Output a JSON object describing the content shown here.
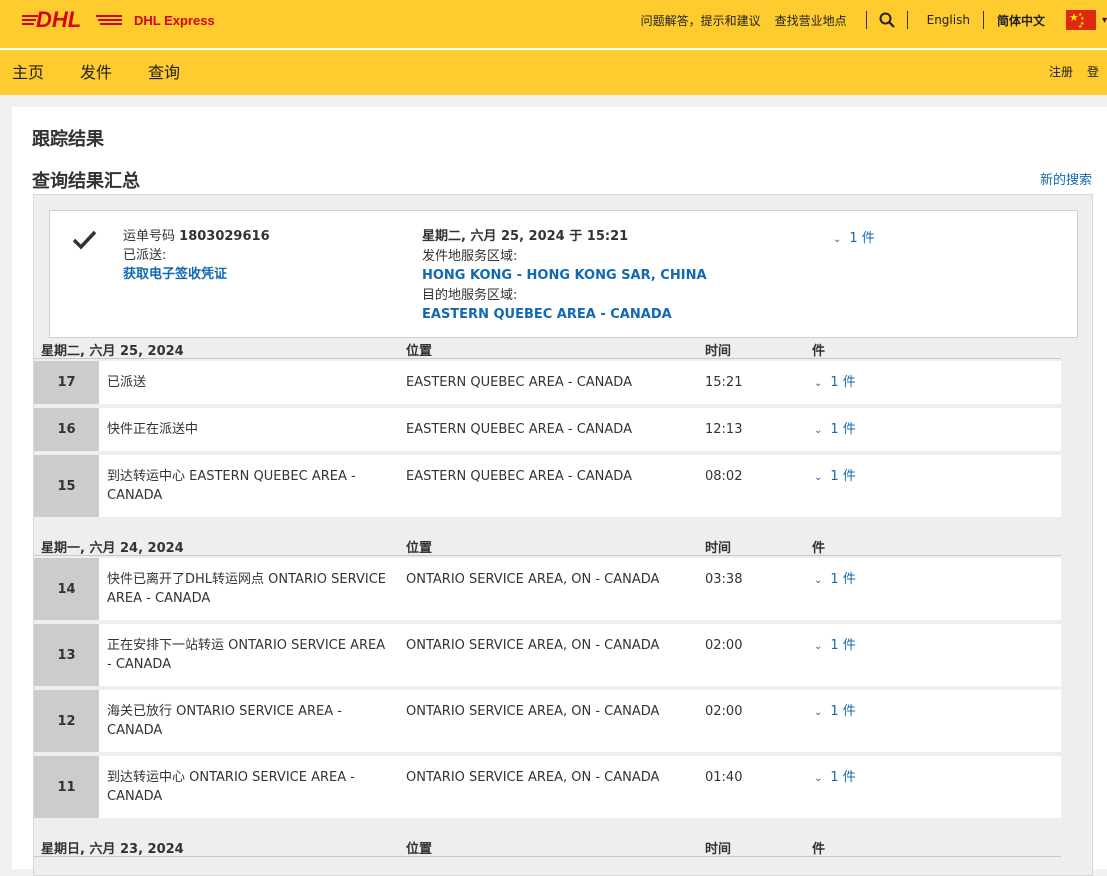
{
  "brand": {
    "logo_text": "DHL",
    "product": "DHL Express",
    "logo_color": "#d40511"
  },
  "top_links": {
    "help": "问题解答，提示和建议",
    "locations": "查找营业地点",
    "english": "English",
    "chinese": "简体中文"
  },
  "nav": {
    "home": "主页",
    "ship": "发件",
    "track": "查询",
    "register": "注册",
    "login": "登录"
  },
  "page": {
    "title": "跟踪结果",
    "subtitle": "查询结果汇总",
    "new_search": "新的搜索"
  },
  "summary": {
    "waybill_label": "运单号码",
    "waybill_number": "1803029616",
    "status": "已派送:",
    "pod_link": "获取电子签收凭证",
    "delivered_datetime": "星期二, 六月 25, 2024 于 15:21",
    "origin_label": "发件地服务区域:",
    "origin": "HONG KONG - HONG KONG SAR, CHINA",
    "dest_label": "目的地服务区域:",
    "destination": "EASTERN QUEBEC AREA - CANADA",
    "pieces": "1 件"
  },
  "columns": {
    "location": "位置",
    "time": "时间",
    "pieces": "件"
  },
  "days": [
    {
      "date": "星期二, 六月 25, 2024"
    },
    {
      "date": "星期一, 六月 24, 2024"
    },
    {
      "date": "星期日, 六月 23, 2024"
    }
  ],
  "events": [
    {
      "num": "17",
      "desc": "已派送",
      "loc": "EASTERN QUEBEC AREA - CANADA",
      "time": "15:21",
      "pieces": "1 件"
    },
    {
      "num": "16",
      "desc": "快件正在派送中",
      "loc": "EASTERN QUEBEC AREA - CANADA",
      "time": "12:13",
      "pieces": "1 件"
    },
    {
      "num": "15",
      "desc": "到达转运中心 EASTERN QUEBEC AREA - CANADA",
      "loc": "EASTERN QUEBEC AREA - CANADA",
      "time": "08:02",
      "pieces": "1 件"
    },
    {
      "num": "14",
      "desc": "快件已离开了DHL转运网点 ONTARIO SERVICE AREA - CANADA",
      "loc": "ONTARIO SERVICE AREA, ON - CANADA",
      "time": "03:38",
      "pieces": "1 件"
    },
    {
      "num": "13",
      "desc": "正在安排下一站转运 ONTARIO SERVICE AREA - CANADA",
      "loc": "ONTARIO SERVICE AREA, ON - CANADA",
      "time": "02:00",
      "pieces": "1 件"
    },
    {
      "num": "12",
      "desc": "海关已放行 ONTARIO SERVICE AREA - CANADA",
      "loc": "ONTARIO SERVICE AREA, ON - CANADA",
      "time": "02:00",
      "pieces": "1 件"
    },
    {
      "num": "11",
      "desc": "到达转运中心 ONTARIO SERVICE AREA - CANADA",
      "loc": "ONTARIO SERVICE AREA, ON - CANADA",
      "time": "01:40",
      "pieces": "1 件"
    }
  ]
}
